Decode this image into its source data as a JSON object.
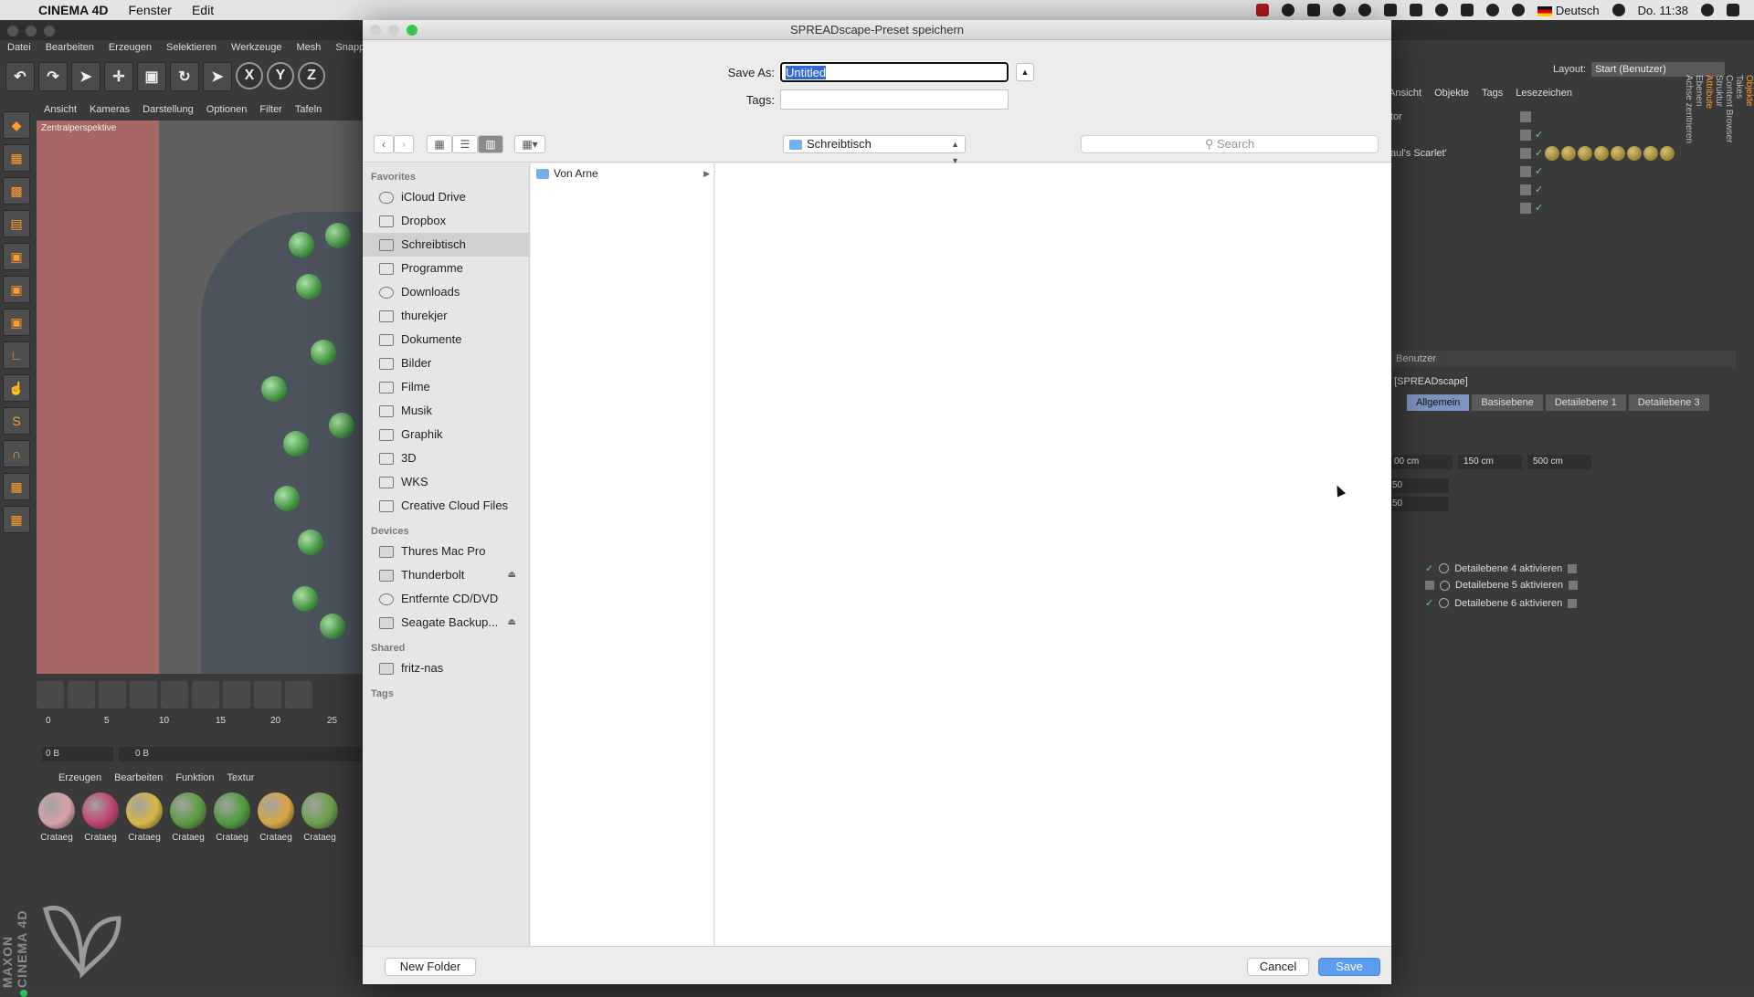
{
  "menubar": {
    "app": "CINEMA 4D",
    "items": [
      "Fenster",
      "Edit"
    ],
    "language": "Deutsch",
    "clock": "Do. 11:38"
  },
  "c4d": {
    "menu": [
      "Datei",
      "Bearbeiten",
      "Erzeugen",
      "Selektieren",
      "Werkzeuge",
      "Mesh",
      "Snappi"
    ],
    "axes": [
      "X",
      "Y",
      "Z"
    ],
    "viewport_menu": [
      "Ansicht",
      "Kameras",
      "Darstellung",
      "Optionen",
      "Filter",
      "Tafeln"
    ],
    "viewport_label": "Zentralperspektive",
    "ruler_ticks": [
      "0",
      "5",
      "10",
      "15",
      "20",
      "25"
    ],
    "frame_field": "0 B",
    "frame_slider": "0 B",
    "material_menu": [
      "Erzeugen",
      "Bearbeiten",
      "Funktion",
      "Textur"
    ],
    "material_name": "Crataeg",
    "material_colors": [
      "#d8a0a8",
      "#c04070",
      "#d9b640",
      "#5a9a3e",
      "#4c9a3a",
      "#d9a640",
      "#6aa048"
    ],
    "logo_text": "MAXON CINEMA 4D",
    "layout_label": "Layout:",
    "layout_value": "Start (Benutzer)",
    "object_menu": [
      "Ansicht",
      "Objekte",
      "Tags",
      "Lesezeichen"
    ],
    "object_rows": [
      "tor",
      "",
      "aul's Scarlet'",
      "",
      "",
      "",
      ""
    ],
    "attr_header": "Benutzer",
    "attr_object": "t [SPREADscape]",
    "attr_tabs": [
      "Allgemein",
      "Basisebene",
      "Detailebene 1",
      "Detailebene 3"
    ],
    "sizes": [
      "00 cm",
      "150 cm",
      "500 cm"
    ],
    "small_fields": [
      "50",
      "50"
    ],
    "detail_rows": [
      "Detailebene 4 aktivieren",
      "Detailebene 5 aktivieren",
      "Detailebene 6 aktivieren"
    ],
    "side_tabs": [
      "Objekte",
      "Takes",
      "Content Browser",
      "Struktur",
      "Attribute",
      "Ebenen",
      "Achse zentrieren"
    ]
  },
  "dialog": {
    "title": "SPREADscape-Preset speichern",
    "save_as_label": "Save As:",
    "save_as_value": "Untitled",
    "tags_label": "Tags:",
    "tags_value": "",
    "location": "Schreibtisch",
    "search_placeholder": "Search",
    "sidebar": {
      "favorites_header": "Favorites",
      "favorites": [
        "iCloud Drive",
        "Dropbox",
        "Schreibtisch",
        "Programme",
        "Downloads",
        "thurekjer",
        "Dokumente",
        "Bilder",
        "Filme",
        "Musik",
        "Graphik",
        "3D",
        "WKS",
        "Creative Cloud Files"
      ],
      "selected": "Schreibtisch",
      "devices_header": "Devices",
      "devices": [
        "Thures Mac Pro",
        "Thunderbolt",
        "Entfernte CD/DVD",
        "Seagate Backup..."
      ],
      "shared_header": "Shared",
      "shared": [
        "fritz-nas"
      ],
      "tags_header": "Tags"
    },
    "column_items": [
      "Von Arne"
    ],
    "buttons": {
      "new_folder": "New Folder",
      "cancel": "Cancel",
      "save": "Save"
    }
  }
}
